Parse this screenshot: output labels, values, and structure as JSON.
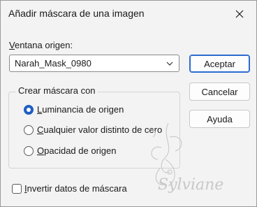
{
  "window": {
    "title": "Añadir máscara de una imagen"
  },
  "source": {
    "label_first": "V",
    "label_rest": "entana origen:",
    "selected": "Narah_Mask_0980"
  },
  "buttons": {
    "ok": "Aceptar",
    "cancel": "Cancelar",
    "help": "Ayuda"
  },
  "group": {
    "legend": "Crear máscara con",
    "options": [
      {
        "first": "L",
        "rest": "uminancia de origen",
        "selected": true
      },
      {
        "first": "C",
        "rest": "ualquier valor distinto de cero",
        "selected": false
      },
      {
        "first": "O",
        "rest": "pacidad de origen",
        "selected": false
      }
    ]
  },
  "invert": {
    "first": "I",
    "rest": "nvertir datos de máscara",
    "checked": false
  },
  "watermark": {
    "text": "Sylviane"
  },
  "colors": {
    "accent": "#1f5fbf",
    "default_button_border": "#2b6ccf"
  }
}
